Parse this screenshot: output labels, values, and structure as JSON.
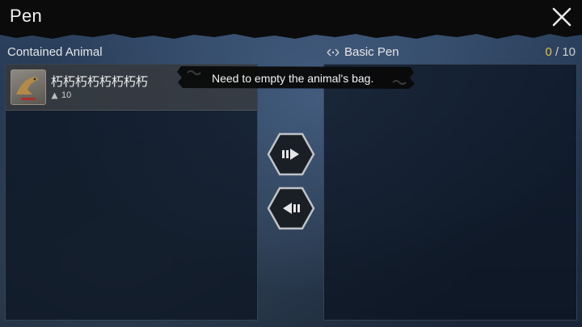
{
  "window": {
    "title": "Pen"
  },
  "left_panel": {
    "label": "Contained Animal",
    "animals": [
      {
        "name": "朽朽朽朽朽朽朽朽",
        "level": "10"
      }
    ]
  },
  "right_panel": {
    "label": "Basic Pen",
    "count_current": "0",
    "count_separator": " / ",
    "count_max": "10"
  },
  "tooltip": {
    "text": "Need to empty the animal's bag."
  },
  "colors": {
    "accent": "#e6c048",
    "topbar": "#0b0b0c"
  },
  "icons": {
    "close": "close-icon",
    "pen": "pen-swap-icon",
    "move_right": "arrow-right-icon",
    "move_left": "arrow-left-icon",
    "level": "level-triangle-icon"
  }
}
